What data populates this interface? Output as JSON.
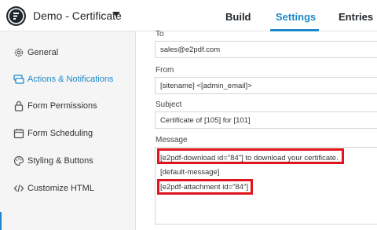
{
  "header": {
    "form_title": "Demo - Certificate",
    "tabs": [
      {
        "label": "Build"
      },
      {
        "label": "Settings"
      },
      {
        "label": "Entries"
      }
    ],
    "accent_color": "#1e88c8"
  },
  "sidebar": {
    "items": [
      {
        "label": "General",
        "icon": "gear-icon"
      },
      {
        "label": "Actions & Notifications",
        "icon": "actions-icon"
      },
      {
        "label": "Form Permissions",
        "icon": "lock-icon"
      },
      {
        "label": "Form Scheduling",
        "icon": "calendar-icon"
      },
      {
        "label": "Styling & Buttons",
        "icon": "palette-icon"
      },
      {
        "label": "Customize HTML",
        "icon": "code-icon"
      }
    ],
    "active_index": 1
  },
  "notification": {
    "to_label": "To",
    "to_value": "sales@e2pdf.com",
    "from_label": "From",
    "from_value": "[sitename] <[admin_email]>",
    "subject_label": "Subject",
    "subject_value": "Certificate of [105] for [101]",
    "message_label": "Message",
    "message_lines": [
      "[e2pdf-download id=\"84\"] to download your certificate.",
      "[default-message]",
      "[e2pdf-attachment id=\"84\"]"
    ],
    "highlight_color": "#e0141e"
  }
}
